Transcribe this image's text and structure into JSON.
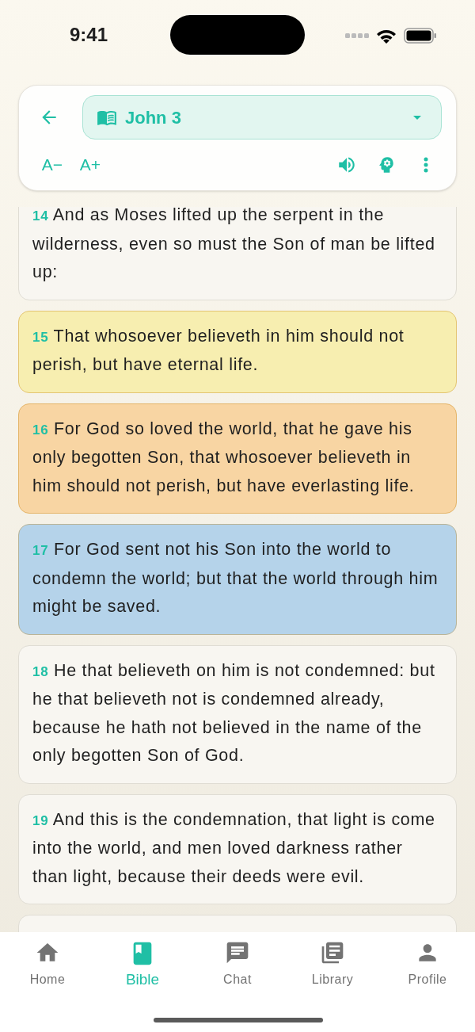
{
  "status_bar": {
    "time": "9:41"
  },
  "header": {
    "title": "John 3",
    "font_buttons": [
      "A−",
      "A+"
    ]
  },
  "verses": [
    {
      "number": "14",
      "text": "And as Moses lifted up the serpent in the wilderness, even so must the Son of man be lifted up:"
    },
    {
      "number": "15",
      "text": "That whosoever believeth in him should not perish, but have eternal life.",
      "color": "#f7eeb0"
    },
    {
      "number": "16",
      "text": "For God so loved the world, that he gave his only begotten Son, that whosoever believeth in him should not perish, but have everlasting life.",
      "color": "#f8d5a3"
    },
    {
      "number": "17",
      "text": "For God sent not his Son into the world to condemn the world; but that the world through him might be saved.",
      "color": "#b5d3ea"
    },
    {
      "number": "18",
      "text": "He that believeth on him is not condemned: but he that believeth not is condemned already, because he hath not believed in the name of the only begotten Son of God."
    },
    {
      "number": "19",
      "text": "And this is the condemnation, that light is come into the world, and men loved darkness rather than light, because their deeds were evil."
    }
  ],
  "tabs": [
    {
      "label": "Home",
      "kind": "home",
      "selected": false
    },
    {
      "label": "Bible",
      "kind": "bible",
      "selected": true
    },
    {
      "label": "Chat",
      "kind": "chat",
      "selected": false
    },
    {
      "label": "Library",
      "kind": "library",
      "selected": false
    },
    {
      "label": "Profile",
      "kind": "profile",
      "selected": false
    }
  ]
}
